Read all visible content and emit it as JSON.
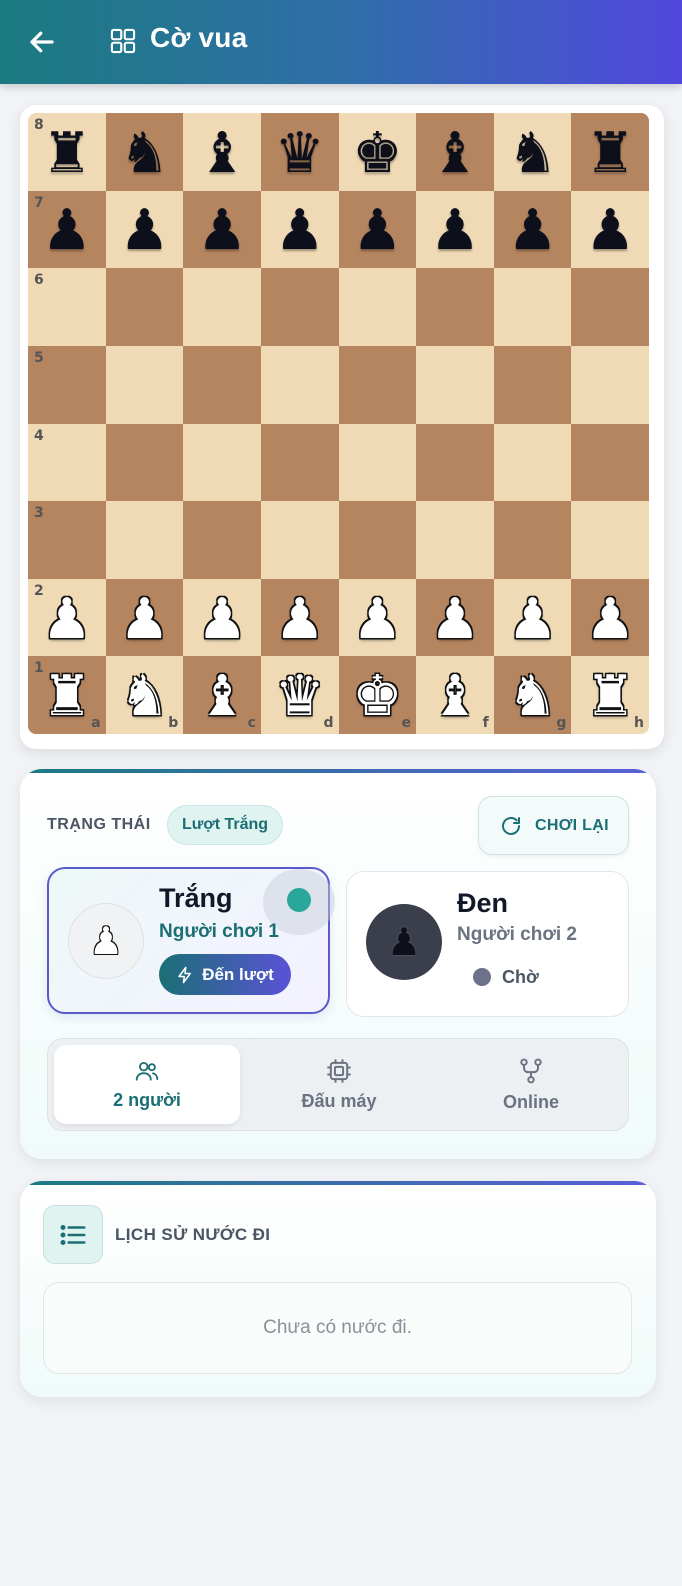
{
  "header": {
    "title": "Cờ vua",
    "back_icon": "arrow-left-icon",
    "app_icon": "grid-icon"
  },
  "board": {
    "rank_labels": [
      "8",
      "7",
      "6",
      "5",
      "4",
      "3",
      "2",
      "1"
    ],
    "file_labels": [
      "a",
      "b",
      "c",
      "d",
      "e",
      "f",
      "g",
      "h"
    ],
    "rows": [
      [
        "br",
        "bn",
        "bb",
        "bq",
        "bk",
        "bb",
        "bn",
        "br"
      ],
      [
        "bp",
        "bp",
        "bp",
        "bp",
        "bp",
        "bp",
        "bp",
        "bp"
      ],
      [
        "",
        "",
        "",
        "",
        "",
        "",
        "",
        ""
      ],
      [
        "",
        "",
        "",
        "",
        "",
        "",
        "",
        ""
      ],
      [
        "",
        "",
        "",
        "",
        "",
        "",
        "",
        ""
      ],
      [
        "",
        "",
        "",
        "",
        "",
        "",
        "",
        ""
      ],
      [
        "wp",
        "wp",
        "wp",
        "wp",
        "wp",
        "wp",
        "wp",
        "wp"
      ],
      [
        "wr",
        "wn",
        "wb",
        "wq",
        "wk",
        "wb",
        "wn",
        "wr"
      ]
    ],
    "colors": {
      "light": "#efdab5",
      "dark": "#b58560"
    }
  },
  "status": {
    "label": "TRẠNG THÁI",
    "turn_badge": "Lượt Trắng",
    "replay_button": "CHƠI LẠI"
  },
  "players": {
    "white": {
      "name": "Trắng",
      "subtitle": "Người chơi 1",
      "turn_label": "Đến lượt"
    },
    "black": {
      "name": "Đen",
      "subtitle": "Người chơi 2",
      "state_label": "Chờ"
    }
  },
  "modes": [
    {
      "label": "2 người",
      "icon": "users-icon",
      "active": true
    },
    {
      "label": "Đấu máy",
      "icon": "cpu-icon",
      "active": false
    },
    {
      "label": "Online",
      "icon": "fork-icon",
      "active": false
    }
  ],
  "history": {
    "title": "LỊCH SỬ NƯỚC ĐI",
    "empty_text": "Chưa có nước đi."
  },
  "colors": {
    "accent_teal": "#1b6f74",
    "accent_indigo": "#5a52d6",
    "active_dot": "#2aa79b"
  }
}
